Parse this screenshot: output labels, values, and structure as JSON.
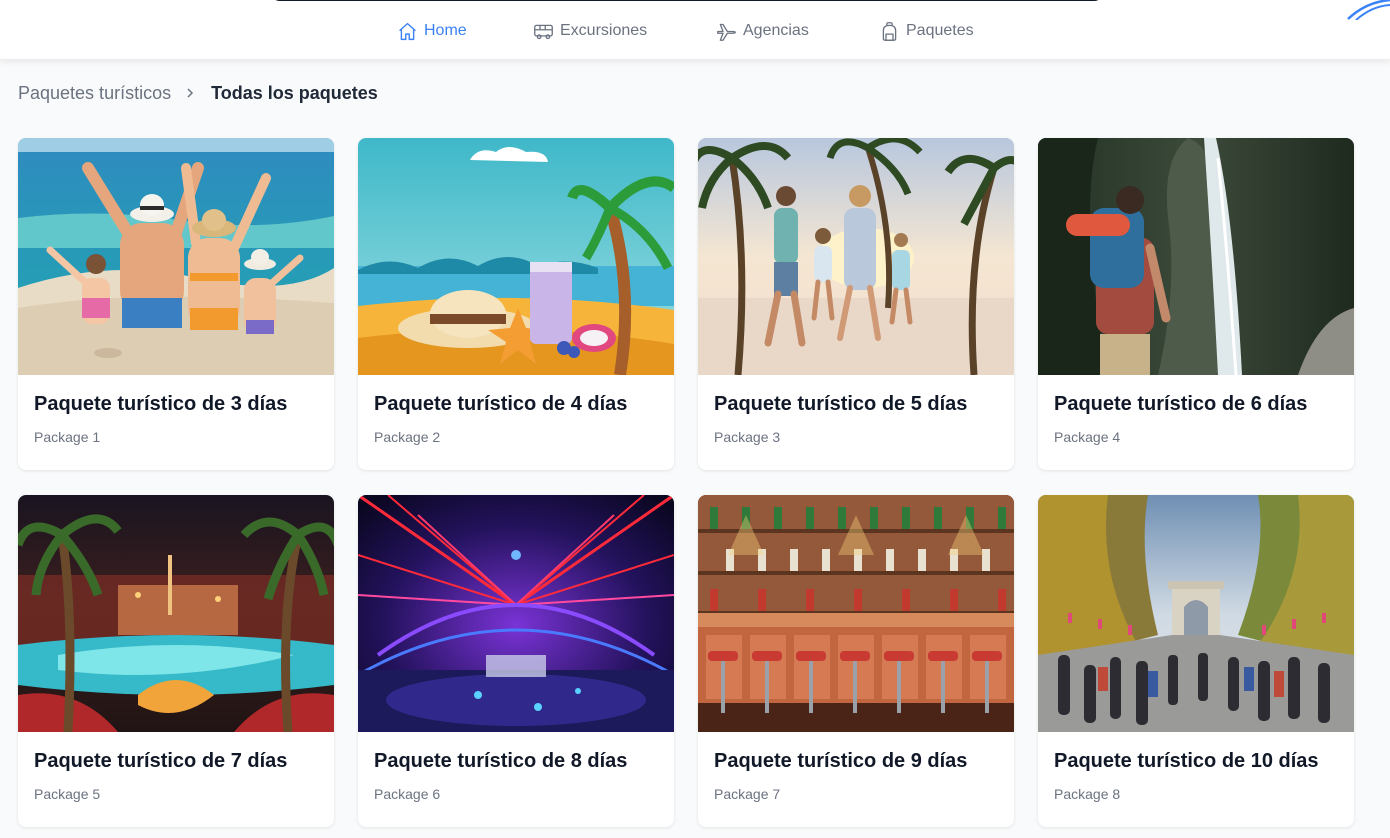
{
  "nav": {
    "items": [
      {
        "label": "Home",
        "icon": "home-icon",
        "active": true
      },
      {
        "label": "Excursiones",
        "icon": "bus-icon",
        "active": false
      },
      {
        "label": "Agencias",
        "icon": "plane-icon",
        "active": false
      },
      {
        "label": "Paquetes",
        "icon": "backpack-icon",
        "active": false
      }
    ]
  },
  "breadcrumb": {
    "parent": "Paquetes turísticos",
    "current": "Todas los paquetes"
  },
  "packages": [
    {
      "title": "Paquete turístico de 3 días",
      "subtitle": "Package 1",
      "image": "family-on-beach"
    },
    {
      "title": "Paquete turístico de 4 días",
      "subtitle": "Package 2",
      "image": "beach-illustration"
    },
    {
      "title": "Paquete turístico de 5 días",
      "subtitle": "Package 3",
      "image": "family-palm-beach"
    },
    {
      "title": "Paquete turístico de 6 días",
      "subtitle": "Package 4",
      "image": "hiker-waterfall"
    },
    {
      "title": "Paquete turístico de 7 días",
      "subtitle": "Package 5",
      "image": "las-vegas-pool-night"
    },
    {
      "title": "Paquete turístico de 8 días",
      "subtitle": "Package 6",
      "image": "neon-nightclub"
    },
    {
      "title": "Paquete turístico de 9 días",
      "subtitle": "Package 7",
      "image": "bar-illustration"
    },
    {
      "title": "Paquete turístico de 10 días",
      "subtitle": "Package 8",
      "image": "champs-elysees-arc"
    }
  ],
  "colors": {
    "accent": "#3b82f6",
    "muted_text": "#6b7280",
    "page_background": "#f9fafb",
    "card_background": "#ffffff"
  }
}
